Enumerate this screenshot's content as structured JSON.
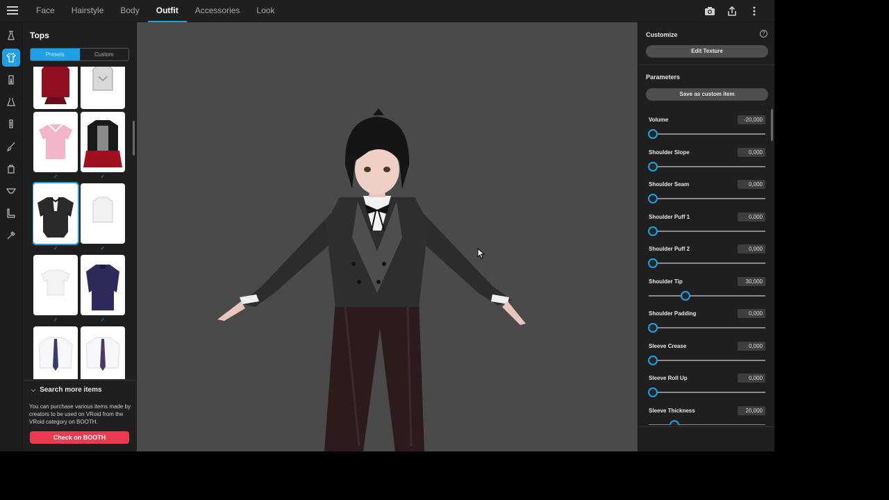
{
  "topbar": {
    "tabs": [
      {
        "label": "Face"
      },
      {
        "label": "Hairstyle"
      },
      {
        "label": "Body"
      },
      {
        "label": "Outfit",
        "active": true
      },
      {
        "label": "Accessories"
      },
      {
        "label": "Look"
      }
    ],
    "actions": [
      "camera-icon",
      "share-icon",
      "more-vertical-icon"
    ]
  },
  "rail": {
    "icons": [
      "dress-icon",
      "shirt-icon",
      "pants-icon",
      "onepiece-icon",
      "socks-icon",
      "brush-icon",
      "bag-icon",
      "underwear-icon",
      "shoe-icon",
      "wand-icon"
    ],
    "active_index": 1
  },
  "left_panel": {
    "title": "Tops",
    "segments": {
      "presets": "Presets",
      "custom": "Custom",
      "selected": "Presets"
    },
    "thumbnails": [
      "red-top",
      "white-blouse",
      "pink-blouse",
      "vampire-outfit",
      "black-tailcoat",
      "white-shirt",
      "white-tshirt",
      "purple-coat",
      "white-shirt-tie",
      "white-shirt-tie-2"
    ],
    "selected_thumbnail": "black-tailcoat",
    "check_glyph": "✓",
    "search_more": {
      "label": "Search more items",
      "description": "You can purchase various items made by creators to be used on VRoid from the VRoid category on BOOTH.",
      "button": "Check on BOOTH"
    }
  },
  "right_panel": {
    "customize_title": "Customize",
    "edit_texture": "Edit Texture",
    "parameters_title": "Parameters",
    "save_custom": "Save as custom item",
    "params": [
      {
        "name": "Volume",
        "value": "-20,000",
        "fraction": 0.0
      },
      {
        "name": "Shoulder Slope",
        "value": "0,000",
        "fraction": 0.0
      },
      {
        "name": "Shoulder Seam",
        "value": "0,000",
        "fraction": 0.0
      },
      {
        "name": "Shoulder Puff 1",
        "value": "0,000",
        "fraction": 0.0
      },
      {
        "name": "Shoulder Puff 2",
        "value": "0,000",
        "fraction": 0.0
      },
      {
        "name": "Shoulder Tip",
        "value": "30,000",
        "fraction": 0.3
      },
      {
        "name": "Shoulder Padding",
        "value": "0,000",
        "fraction": 0.0
      },
      {
        "name": "Sleeve Crease",
        "value": "0,000",
        "fraction": 0.0
      },
      {
        "name": "Sleeve Roll Up",
        "value": "0,000",
        "fraction": 0.0
      },
      {
        "name": "Sleeve Thickness",
        "value": "20,000",
        "fraction": 0.2
      }
    ]
  },
  "colors": {
    "accent": "#1ea0e8",
    "booth": "#ee3a4f"
  }
}
